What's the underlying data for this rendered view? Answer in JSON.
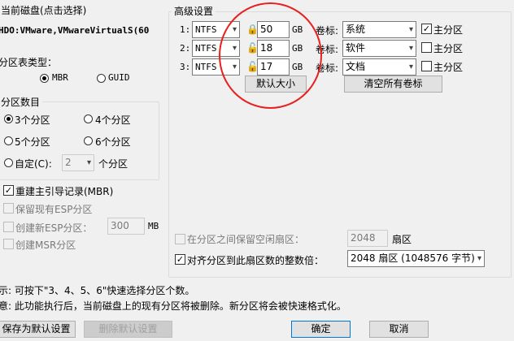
{
  "left": {
    "disk_title": "当前磁盘(点击选择)",
    "disk_value": "HDO:VMware,VMwareVirtualS(60",
    "partition_type_title": "分区表类型：",
    "mbr_label": "MBR",
    "guid_label": "GUID",
    "partition_count_title": "分区数目",
    "count_options": [
      "3个分区",
      "4个分区",
      "5个分区",
      "6个分区"
    ],
    "custom_label": "自定(C):",
    "custom_value": "2",
    "custom_suffix": "个分区",
    "rebuild_mbr": "重建主引导记录(MBR)",
    "keep_esp": "保留现有ESP分区",
    "create_esp": "创建新ESP分区：",
    "esp_size": "300",
    "esp_unit": "MB",
    "create_msr": "创建MSR分区"
  },
  "advanced": {
    "title": "高级设置",
    "rows": [
      {
        "index": "1:",
        "fs": "NTFS",
        "size": "50",
        "unit": "GB",
        "vol_label_text": "卷标:",
        "vol": "系统",
        "primary_checked": true,
        "primary_label": "主分区"
      },
      {
        "index": "2:",
        "fs": "NTFS",
        "size": "18",
        "unit": "GB",
        "vol_label_text": "卷标:",
        "vol": "软件",
        "primary_checked": false,
        "primary_label": "主分区"
      },
      {
        "index": "3:",
        "fs": "NTFS",
        "size": "17",
        "unit": "GB",
        "vol_label_text": "卷标:",
        "vol": "文档",
        "primary_checked": false,
        "primary_label": "主分区"
      }
    ],
    "default_size_button": "默认大小",
    "clear_labels_button": "清空所有卷标",
    "keep_free_label": "在分区之间保留空闲扇区：",
    "keep_free_value": "2048",
    "keep_free_unit": "扇区",
    "align_label": "对齐分区到此扇区数的整数倍：",
    "align_value": "2048 扇区 (1048576 字节)"
  },
  "hints": {
    "line1": "示: 可按下\"3、4、5、6\"快速选择分区个数。",
    "line2": "意: 此功能执行后，当前磁盘上的现有分区将被删除。新分区将会被快速格式化。"
  },
  "buttons": {
    "save_default": "保存为默认设置",
    "delete_default": "删除默认设置",
    "ok": "确定",
    "cancel": "取消"
  },
  "annotation_color": "#e8201e",
  "icons": {
    "lock": "lock-icon",
    "unlock": "unlock-icon",
    "dropdown": "chevron-down-icon"
  }
}
